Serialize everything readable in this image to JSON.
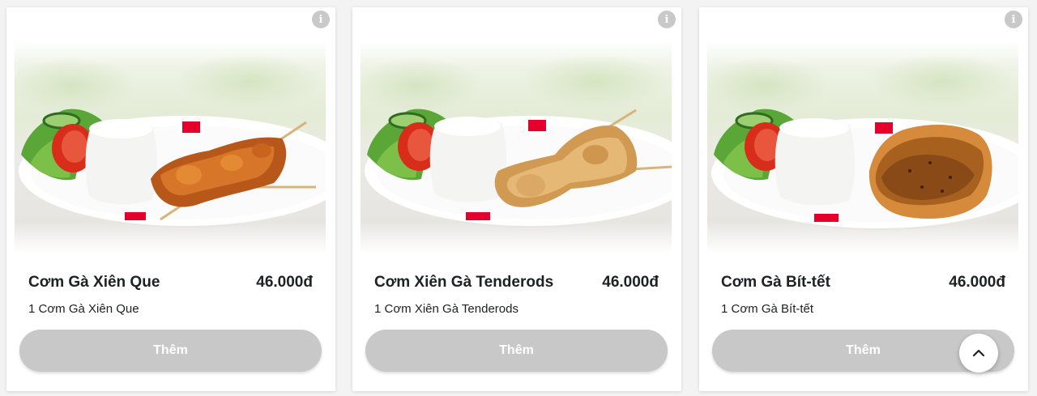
{
  "products": [
    {
      "name": "Cơm Gà Xiên Que",
      "price": "46.000đ",
      "description": "1 Cơm Gà Xiên Que",
      "button_label": "Thêm",
      "info_icon": "i",
      "image": "rice-plate-chicken-skewer"
    },
    {
      "name": "Cơm Xiên Gà Tenderods",
      "price": "46.000đ",
      "description": "1 Cơm Xiên Gà Tenderods",
      "button_label": "Thêm",
      "info_icon": "i",
      "image": "rice-plate-fried-tenderods"
    },
    {
      "name": "Cơm Gà Bít-tết",
      "price": "46.000đ",
      "description": "1 Cơm Gà Bít-tết",
      "button_label": "Thêm",
      "info_icon": "i",
      "image": "rice-plate-chicken-steak"
    }
  ],
  "scroll_top_icon": "chevron-up-icon",
  "colors": {
    "button_bg": "#c8c8c8",
    "button_text": "#ffffff",
    "brand_red": "#e4002b",
    "text": "#202124"
  }
}
